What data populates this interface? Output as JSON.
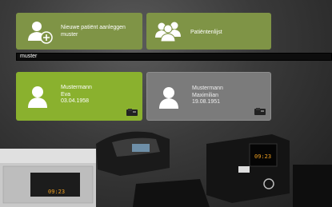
{
  "tiles": {
    "new_patient": "Nieuwe patiënt aanleggen muster",
    "patient_list": "Patiëntenlijst"
  },
  "search": {
    "value": "muster"
  },
  "patients": [
    {
      "last_name": "Mustermann",
      "first_name": "Eva",
      "birth_date": "03.04.1958",
      "selected": true
    },
    {
      "last_name": "Mustermann",
      "first_name": "Maximilian",
      "birth_date": "19.08.1951",
      "selected": false
    }
  ],
  "devices": {
    "display_left": "09:23",
    "display_right": "09:23"
  },
  "colors": {
    "tile_green": "#7f9446",
    "selected_green": "#8ab12e",
    "card_gray": "#7b7b7b"
  }
}
